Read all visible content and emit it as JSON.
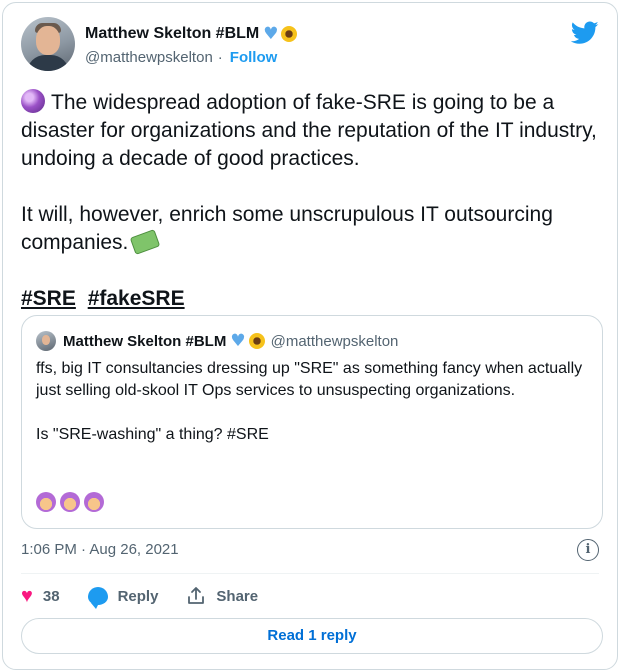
{
  "author": {
    "name": "Matthew Skelton #BLM",
    "handle": "@matthewpskelton",
    "separator": "·",
    "follow_label": "Follow"
  },
  "tweet": {
    "paragraph1": "The widespread adoption of fake-SRE is going to be a disaster for organizations and the reputation of the IT industry, undoing a decade of good practices.",
    "paragraph2": "It will, however, enrich some unscrupulous IT outsourcing companies.",
    "hashtags": [
      "#SRE",
      "#fakeSRE"
    ],
    "timestamp": "1:06 PM · Aug 26, 2021"
  },
  "quoted_tweet": {
    "name": "Matthew Skelton #BLM",
    "handle": "@matthewpskelton",
    "paragraph1": "ffs, big IT consultancies dressing up \"SRE\" as something fancy when actually just selling old-skool IT Ops services to unsuspecting organizations.",
    "paragraph2": "Is \"SRE-washing\" a thing? #SRE"
  },
  "actions": {
    "like_count": "38",
    "reply_label": "Reply",
    "share_label": "Share"
  },
  "read_reply_label": "Read 1 reply",
  "colors": {
    "accent": "#1d9bf0",
    "like": "#f91880",
    "text": "#0f1419",
    "muted": "#536471",
    "border": "#cfd9de"
  }
}
